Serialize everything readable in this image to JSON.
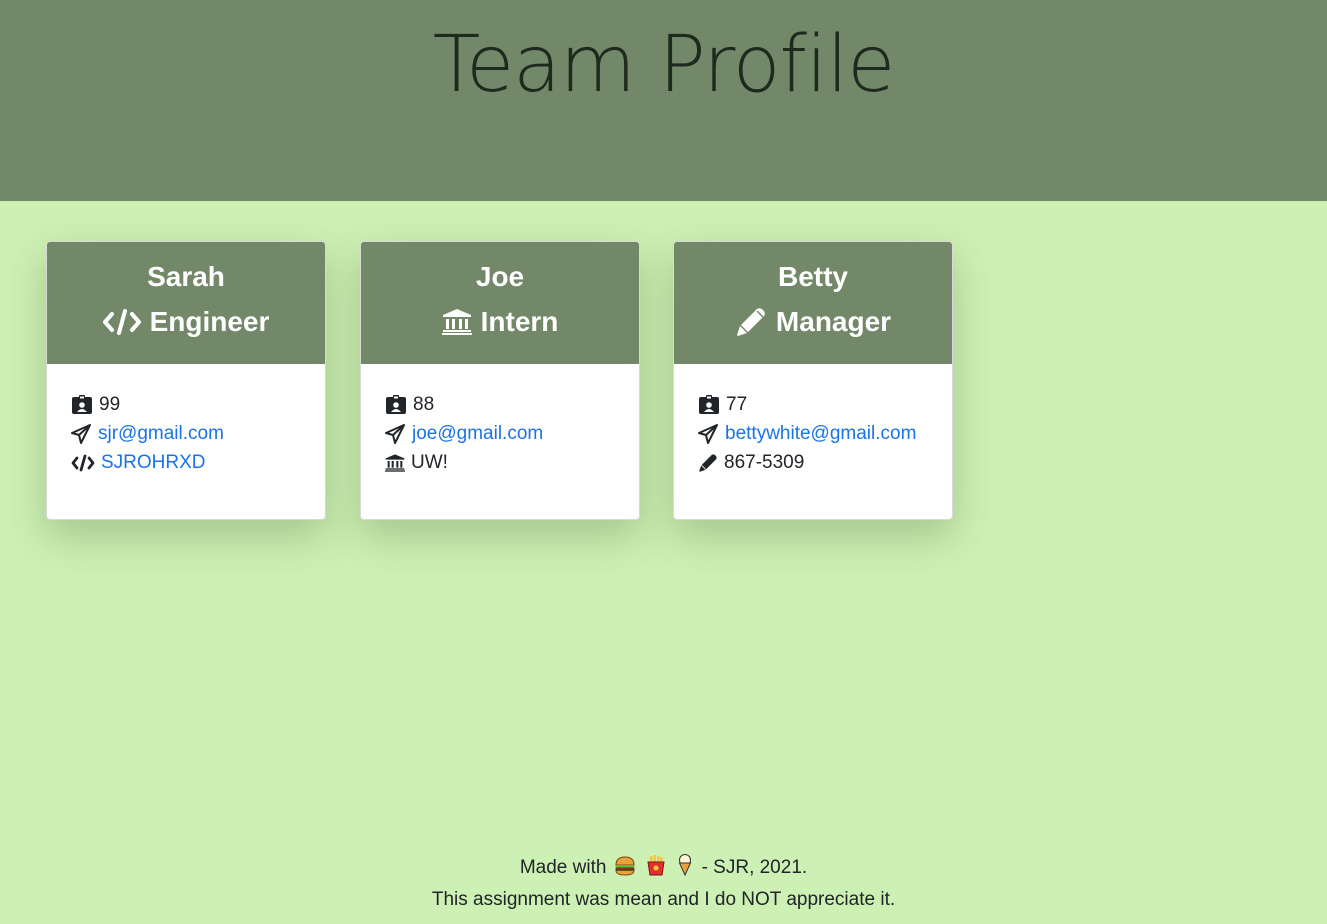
{
  "header": {
    "title": "Team Profile"
  },
  "employees": [
    {
      "name": "Sarah",
      "role": "Engineer",
      "role_icon": "code-icon",
      "id": "99",
      "email": "sjr@gmail.com",
      "extra_icon": "code-icon",
      "extra": "SJROHRXD"
    },
    {
      "name": "Joe",
      "role": "Intern",
      "role_icon": "bank-icon",
      "id": "88",
      "email": "joe@gmail.com",
      "extra_icon": "bank-icon",
      "extra": "UW!"
    },
    {
      "name": "Betty",
      "role": "Manager",
      "role_icon": "pen-icon",
      "id": "77",
      "email": "bettywhite@gmail.com",
      "extra_icon": "pen-icon",
      "extra": "867-5309"
    }
  ],
  "footer": {
    "made_with": "Made with",
    "emojis": [
      "hamburger-icon",
      "fries-icon",
      "ice-cream-icon"
    ],
    "credit": "- SJR, 2021.",
    "note": "This assignment was mean and I do NOT appreciate it."
  },
  "colors": {
    "background": "#cdf0b4",
    "header": "#728868",
    "link": "#1a73e8"
  }
}
